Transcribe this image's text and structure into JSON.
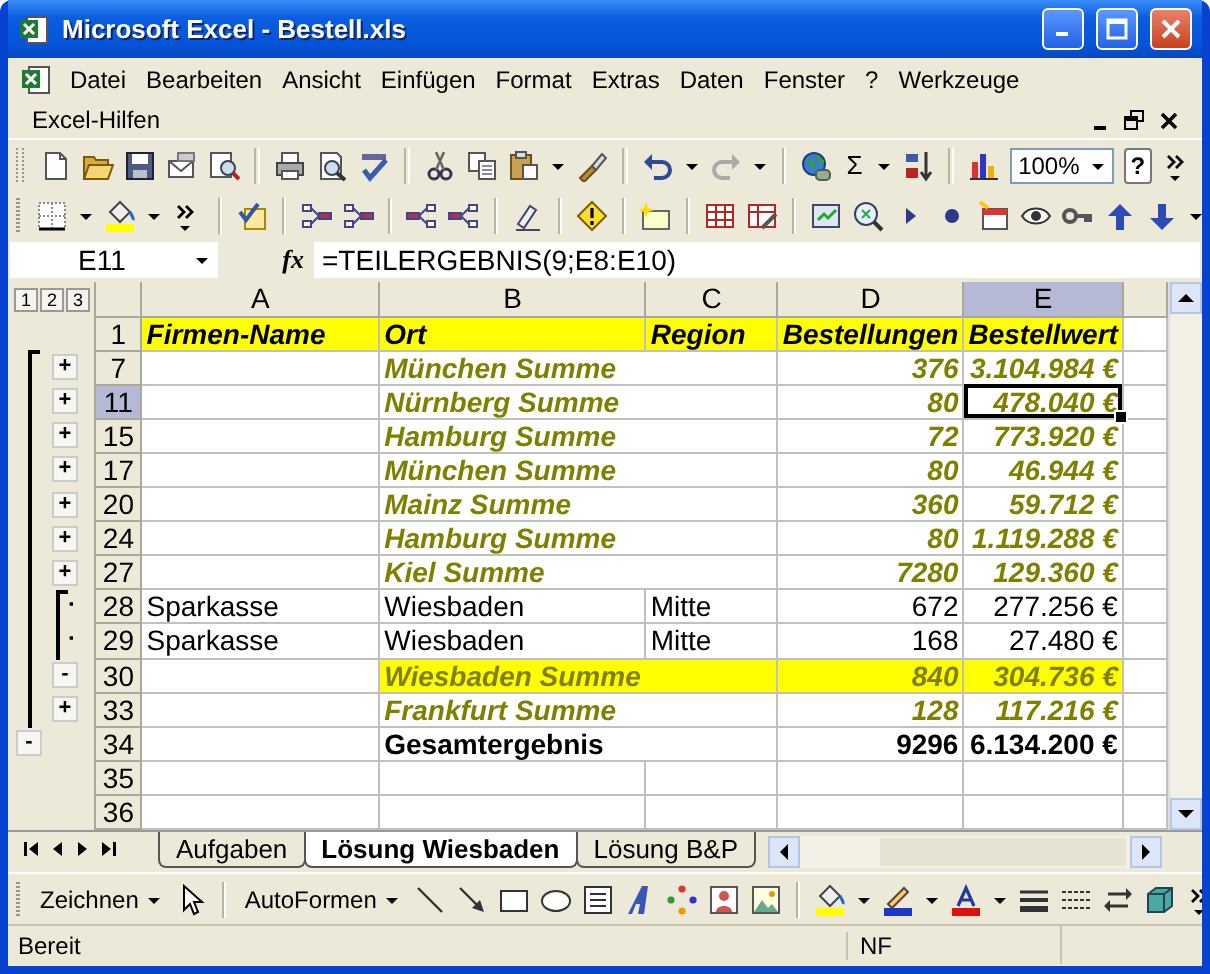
{
  "window": {
    "title": "Microsoft Excel - Bestell.xls"
  },
  "menu": [
    {
      "label": "Datei"
    },
    {
      "label": "Bearbeiten"
    },
    {
      "label": "Ansicht"
    },
    {
      "label": "Einfügen"
    },
    {
      "label": "Format"
    },
    {
      "label": "Extras"
    },
    {
      "label": "Daten"
    },
    {
      "label": "Fenster"
    },
    {
      "label": "?"
    },
    {
      "label": "Werkzeuge"
    }
  ],
  "help_menu": "Excel-Hilfen",
  "standard_toolbar": {
    "sum_button": "Σ",
    "zoom": "100%",
    "help_button": "?"
  },
  "formula_bar": {
    "name_box": "E11",
    "function_symbol": "fx",
    "formula": "=TEILERGEBNIS(9;E8:E10)"
  },
  "outline_levels": [
    "1",
    "2",
    "3"
  ],
  "columns": [
    {
      "label": "A",
      "selected": false
    },
    {
      "label": "B",
      "selected": false
    },
    {
      "label": "C",
      "selected": false
    },
    {
      "label": "D",
      "selected": false
    },
    {
      "label": "E",
      "selected": true
    }
  ],
  "rows": [
    {
      "number": "1",
      "kind": "header",
      "selected": false,
      "highlighted": false,
      "cells": {
        "A": "Firmen-Name",
        "B": "Ort",
        "C": "Region",
        "D": "Bestellungen",
        "E": "Bestellwert"
      }
    },
    {
      "number": "7",
      "kind": "subtotal",
      "selected": false,
      "highlighted": false,
      "outline": {
        "symbol": "+",
        "kind": "button"
      },
      "cells": {
        "B": "München Summe",
        "D": "376",
        "E": "3.104.984 €"
      }
    },
    {
      "number": "11",
      "kind": "subtotal",
      "selected": true,
      "highlighted": false,
      "outline": {
        "symbol": "+",
        "kind": "button"
      },
      "cells": {
        "B": "Nürnberg Summe",
        "D": "80",
        "E": "478.040 €"
      }
    },
    {
      "number": "15",
      "kind": "subtotal",
      "selected": false,
      "highlighted": false,
      "outline": {
        "symbol": "+",
        "kind": "button"
      },
      "cells": {
        "B": "Hamburg Summe",
        "D": "72",
        "E": "773.920 €"
      }
    },
    {
      "number": "17",
      "kind": "subtotal",
      "selected": false,
      "highlighted": false,
      "outline": {
        "symbol": "+",
        "kind": "button"
      },
      "cells": {
        "B": "München Summe",
        "D": "80",
        "E": "46.944 €"
      }
    },
    {
      "number": "20",
      "kind": "subtotal",
      "selected": false,
      "highlighted": false,
      "outline": {
        "symbol": "+",
        "kind": "button"
      },
      "cells": {
        "B": "Mainz Summe",
        "D": "360",
        "E": "59.712 €"
      }
    },
    {
      "number": "24",
      "kind": "subtotal",
      "selected": false,
      "highlighted": false,
      "outline": {
        "symbol": "+",
        "kind": "button"
      },
      "cells": {
        "B": "Hamburg Summe",
        "D": "80",
        "E": "1.119.288 €"
      }
    },
    {
      "number": "27",
      "kind": "subtotal",
      "selected": false,
      "highlighted": false,
      "outline": {
        "symbol": "+",
        "kind": "button"
      },
      "cells": {
        "B": "Kiel Summe",
        "D": "7280",
        "E": "129.360 €"
      }
    },
    {
      "number": "28",
      "kind": "detail",
      "selected": false,
      "highlighted": false,
      "outline": {
        "symbol": "·",
        "kind": "mark"
      },
      "cells": {
        "A": "Sparkasse",
        "B": "Wiesbaden",
        "C": "Mitte",
        "D": "672",
        "E": "277.256 €"
      }
    },
    {
      "number": "29",
      "kind": "detail",
      "selected": false,
      "highlighted": false,
      "outline": {
        "symbol": "·",
        "kind": "mark"
      },
      "cells": {
        "A": "Sparkasse",
        "B": "Wiesbaden",
        "C": "Mitte",
        "D": "168",
        "E": "27.480 €"
      }
    },
    {
      "number": "30",
      "kind": "subtotal",
      "selected": false,
      "highlighted": true,
      "outline": {
        "symbol": "-",
        "kind": "button"
      },
      "cells": {
        "B": "Wiesbaden Summe",
        "D": "840",
        "E": "304.736 €"
      }
    },
    {
      "number": "33",
      "kind": "subtotal",
      "selected": false,
      "highlighted": false,
      "outline": {
        "symbol": "+",
        "kind": "button"
      },
      "cells": {
        "B": "Frankfurt Summe",
        "D": "128",
        "E": "117.216 €"
      }
    },
    {
      "number": "34",
      "kind": "total",
      "selected": false,
      "highlighted": false,
      "outline": {
        "symbol": "-",
        "kind": "outer"
      },
      "cells": {
        "B": "Gesamtergebnis",
        "D": "9296",
        "E": "6.134.200 €"
      }
    },
    {
      "number": "35",
      "kind": "empty",
      "selected": false,
      "highlighted": false,
      "cells": {}
    },
    {
      "number": "36",
      "kind": "empty",
      "selected": false,
      "highlighted": false,
      "cells": {}
    }
  ],
  "sheet_tabs": [
    {
      "label": "Aufgaben",
      "selected": false
    },
    {
      "label": "Lösung Wiesbaden",
      "selected": true
    },
    {
      "label": "Lösung B&P",
      "selected": false
    }
  ],
  "drawing_toolbar": {
    "draw_menu": {
      "label": "Zeichnen"
    },
    "autoshapes_menu": {
      "label": "AutoFormen"
    }
  },
  "status_bar": {
    "message": "Bereit",
    "indicator": "NF"
  }
}
